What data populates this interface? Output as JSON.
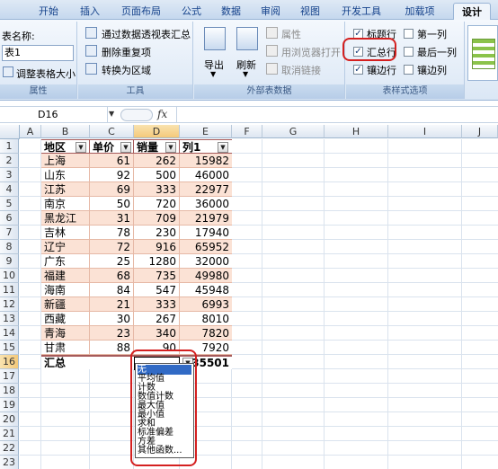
{
  "ribbon_tabs": [
    "开始",
    "插入",
    "页面布局",
    "公式",
    "数据",
    "审阅",
    "视图",
    "开发工具",
    "加载项",
    "设计"
  ],
  "properties_group": {
    "table_name_label": "表名称:",
    "table_name_value": "表1",
    "resize_button": "调整表格大小",
    "label": "属性"
  },
  "tools_group": {
    "pivot_summary": "通过数据透视表汇总",
    "remove_duplicates": "删除重复项",
    "convert_to_range": "转换为区域",
    "label": "工具"
  },
  "external_group": {
    "export": "导出",
    "refresh": "刷新",
    "properties": "属性",
    "open_in_browser": "用浏览器打开",
    "unlink": "取消链接",
    "label": "外部表数据"
  },
  "style_options": {
    "header_row": "标题行",
    "total_row": "汇总行",
    "banded_rows": "镶边行",
    "first_column": "第一列",
    "last_column": "最后一列",
    "banded_columns": "镶边列",
    "label": "表样式选项",
    "checked": {
      "header_row": true,
      "total_row": true,
      "banded_rows": true,
      "first_column": false,
      "last_column": false,
      "banded_columns": false
    }
  },
  "formula_bar": {
    "name_box": "D16",
    "fx": "fx",
    "formula": ""
  },
  "columns": [
    "A",
    "B",
    "C",
    "D",
    "E",
    "F",
    "G",
    "H",
    "I",
    "J"
  ],
  "rows": [
    "1",
    "2",
    "3",
    "4",
    "5",
    "6",
    "7",
    "8",
    "9",
    "10",
    "11",
    "12",
    "13",
    "14",
    "15",
    "16",
    "17",
    "18",
    "19",
    "20",
    "21",
    "22",
    "23"
  ],
  "table": {
    "headers": [
      "地区",
      "单价",
      "销量",
      "列1"
    ],
    "data": [
      [
        "上海",
        "61",
        "262",
        "15982"
      ],
      [
        "山东",
        "92",
        "500",
        "46000"
      ],
      [
        "江苏",
        "69",
        "333",
        "22977"
      ],
      [
        "南京",
        "50",
        "720",
        "36000"
      ],
      [
        "黑龙江",
        "31",
        "709",
        "21979"
      ],
      [
        "吉林",
        "78",
        "230",
        "17940"
      ],
      [
        "辽宁",
        "72",
        "916",
        "65952"
      ],
      [
        "广东",
        "25",
        "1280",
        "32000"
      ],
      [
        "福建",
        "68",
        "735",
        "49980"
      ],
      [
        "海南",
        "84",
        "547",
        "45948"
      ],
      [
        "新疆",
        "21",
        "333",
        "6993"
      ],
      [
        "西藏",
        "30",
        "267",
        "8010"
      ],
      [
        "青海",
        "23",
        "340",
        "7820"
      ],
      [
        "甘肃",
        "88",
        "90",
        "7920"
      ]
    ],
    "total_label": "汇总",
    "total_value": "35501"
  },
  "total_dropdown_options": [
    "无",
    "平均值",
    "计数",
    "数值计数",
    "最大值",
    "最小值",
    "求和",
    "标准偏差",
    "方差",
    "其他函数..."
  ],
  "colors": {
    "band": "#fbe2d5",
    "accent_red": "#d42020",
    "selected": "#316ac5"
  }
}
